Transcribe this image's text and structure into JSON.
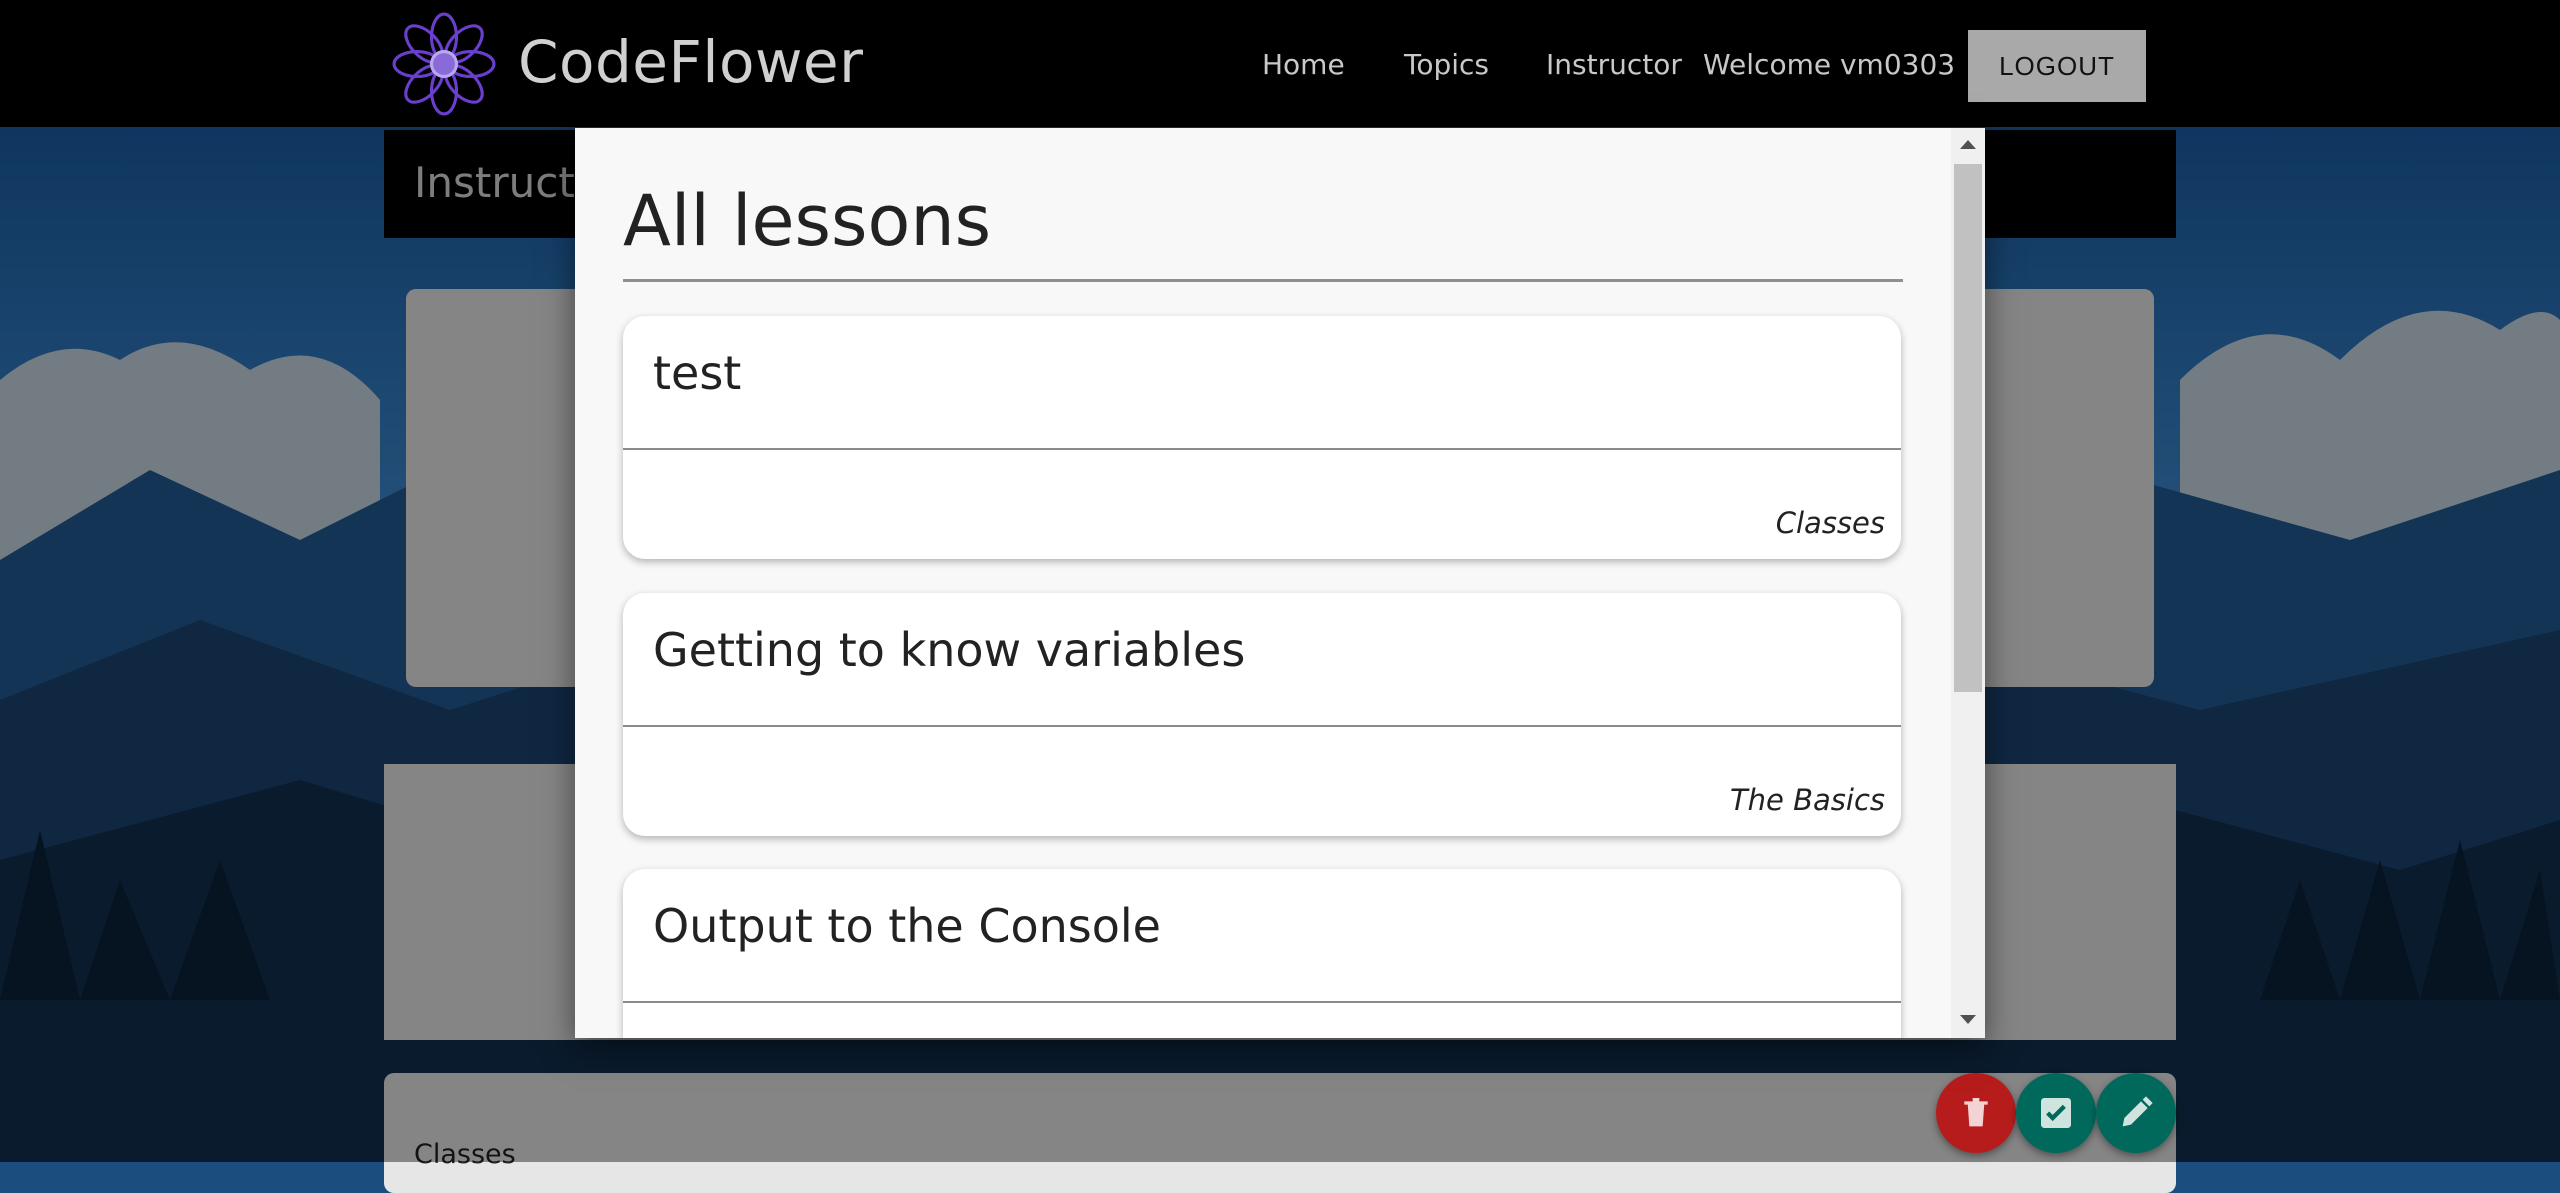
{
  "brand": {
    "name": "CodeFlower"
  },
  "nav": {
    "links": [
      "Home",
      "Topics",
      "Instructor"
    ],
    "welcome": "Welcome vm0303",
    "logout": "LOGOUT"
  },
  "page": {
    "header_title": "Instructo",
    "bottom_card_label": "Classes"
  },
  "fab_actions": [
    {
      "icon": "trash-icon",
      "color": "#b71c1c"
    },
    {
      "icon": "checkbox-icon",
      "color": "#00695c"
    },
    {
      "icon": "pencil-icon",
      "color": "#00695c"
    }
  ],
  "modal": {
    "title": "All lessons",
    "lessons": [
      {
        "title": "test",
        "topic": "Classes"
      },
      {
        "title": "Getting to know variables",
        "topic": "The Basics"
      },
      {
        "title": "Output to the Console",
        "topic": ""
      }
    ]
  },
  "colors": {
    "navbar": "#000000",
    "logo_purple": "#6a3fd0",
    "accent_red": "#b71c1c",
    "accent_teal": "#00695c"
  }
}
